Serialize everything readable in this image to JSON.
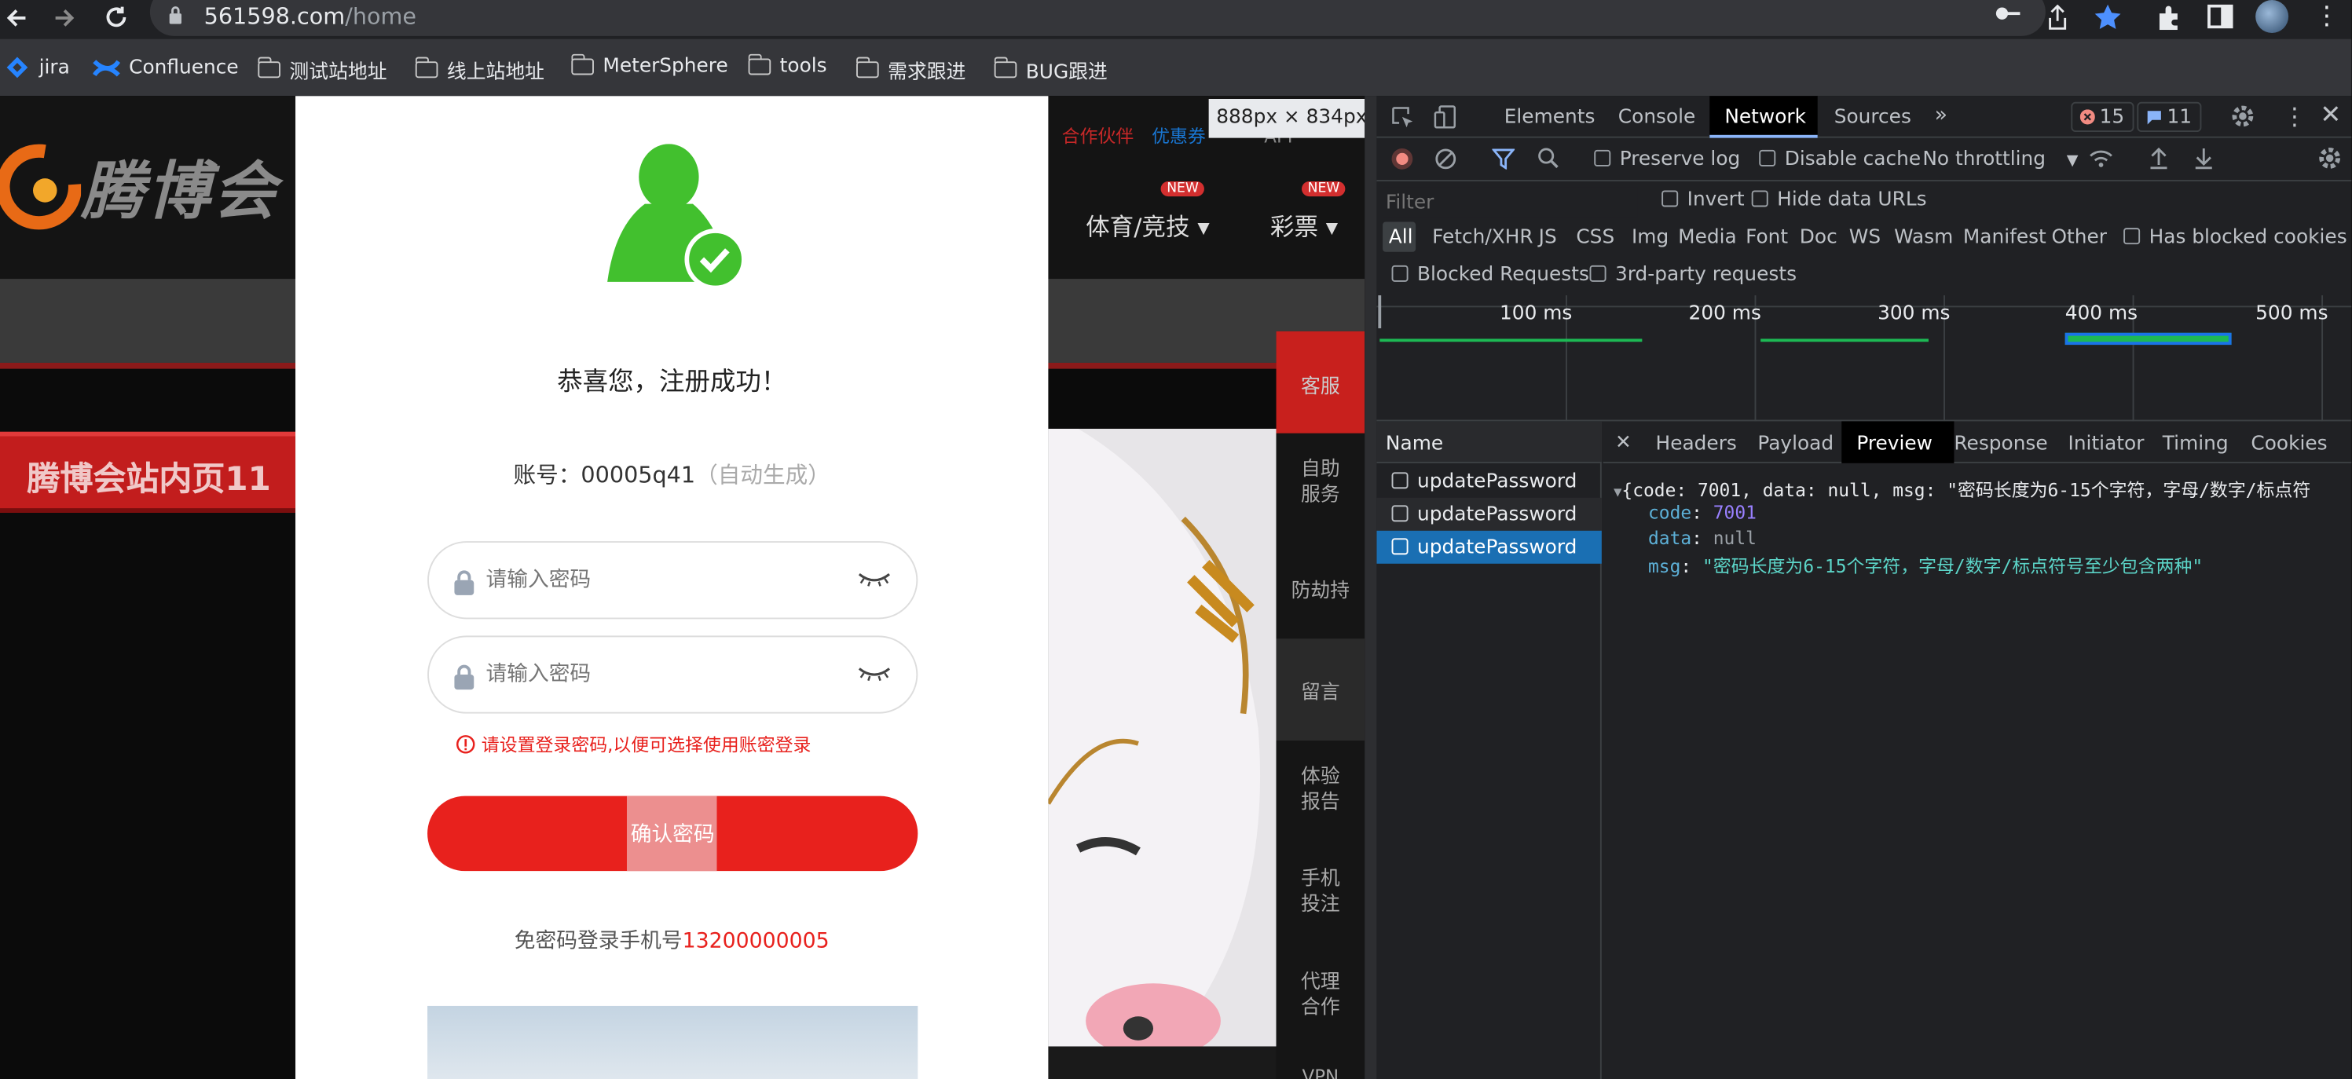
{
  "browser": {
    "url_host": "561598.com",
    "url_path": "/home",
    "bookmarks": [
      "jira",
      "Confluence",
      "测试站地址",
      "线上站地址",
      "MeterSphere",
      "tools",
      "需求跟进",
      "BUG跟进"
    ]
  },
  "site": {
    "logo_text": "腾博会",
    "inner_page_banner": "腾博会站内页11",
    "top_links": [
      "合作伙伴",
      "优惠券"
    ],
    "app_label": "APP",
    "nav": [
      {
        "label": "体育/竞技",
        "badge": "NEW"
      },
      {
        "label": "彩票",
        "badge": "NEW"
      }
    ],
    "side_menu": [
      "客服",
      "自助\n服务",
      "防劫持",
      "留言",
      "体验\n报告",
      "手机\n投注",
      "代理\n合作",
      "VPN"
    ]
  },
  "modal": {
    "title": "恭喜您，注册成功！",
    "account_label": "账号：",
    "account_value": "00005q41",
    "account_note": "（自动生成）",
    "password_placeholder": "请输入密码",
    "confirm_placeholder": "请输入密码",
    "error_text": "请设置登录密码,以便可选择使用账密登录",
    "confirm_button": "确认密码",
    "free_login_label": "免密码登录手机号",
    "phone": "13200000005"
  },
  "devtools": {
    "size_tooltip": "888px × 834px",
    "tabs": [
      "Elements",
      "Console",
      "Network",
      "Sources"
    ],
    "active_tab": "Network",
    "error_count": "15",
    "message_count": "11",
    "toolbar": {
      "preserve_log": "Preserve log",
      "disable_cache": "Disable cache",
      "throttling": "No throttling"
    },
    "filter_placeholder": "Filter",
    "invert": "Invert",
    "hide_data_urls": "Hide data URLs",
    "type_filters": [
      "All",
      "Fetch/XHR",
      "JS",
      "CSS",
      "Img",
      "Media",
      "Font",
      "Doc",
      "WS",
      "Wasm",
      "Manifest",
      "Other"
    ],
    "has_blocked_cookies": "Has blocked cookies",
    "blocked_requests": "Blocked Requests",
    "third_party": "3rd-party requests",
    "timeline_ticks": [
      "100 ms",
      "200 ms",
      "300 ms",
      "400 ms",
      "500 ms"
    ],
    "name_header": "Name",
    "requests": [
      "updatePassword",
      "updatePassword",
      "updatePassword"
    ],
    "detail_tabs": [
      "Headers",
      "Payload",
      "Preview",
      "Response",
      "Initiator",
      "Timing",
      "Cookies"
    ],
    "active_detail_tab": "Preview",
    "preview": {
      "summary": "{code: 7001, data: null, msg: \"密码长度为6-15个字符，字母/数字/标点符",
      "code_key": "code",
      "code_value": "7001",
      "data_key": "data",
      "data_value": "null",
      "msg_key": "msg",
      "msg_value": "\"密码长度为6-15个字符，字母/数字/标点符号至少包含两种\""
    }
  },
  "colors": {
    "brand_red": "#e8211d",
    "green": "#42c02e",
    "devtools_bg": "#202124",
    "selected_blue": "#1a6fb3"
  }
}
